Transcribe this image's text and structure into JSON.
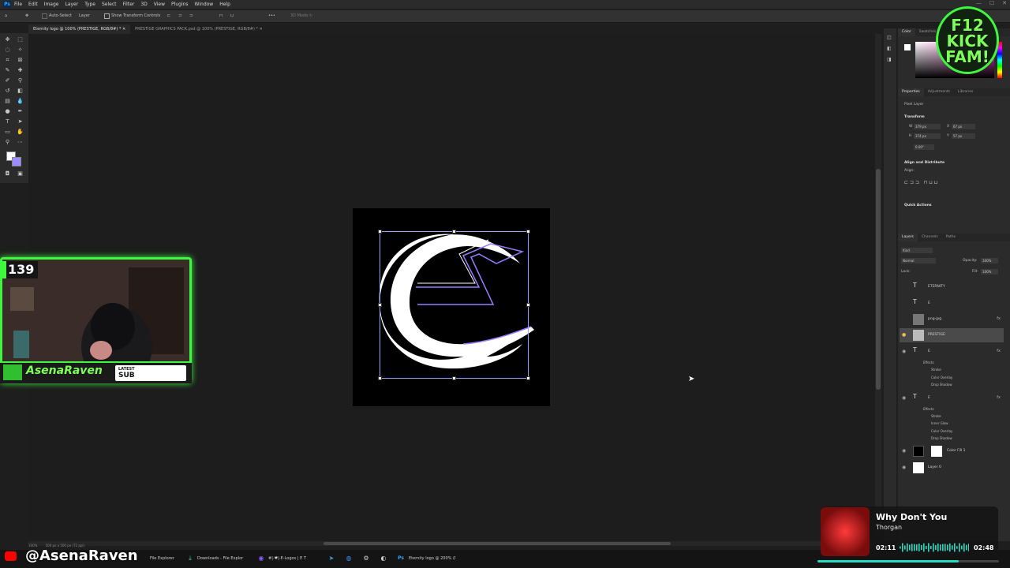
{
  "menubar": {
    "logo": "Ps",
    "items": [
      "File",
      "Edit",
      "Image",
      "Layer",
      "Type",
      "Select",
      "Filter",
      "3D",
      "View",
      "Plugins",
      "Window",
      "Help"
    ]
  },
  "options": {
    "auto_select": "Auto-Select",
    "target": "Layer",
    "transform_controls": "Show Transform Controls",
    "mode_3d": "3D Mode:"
  },
  "tabs": [
    {
      "label": "Eternity logo @ 100% (PRESTIGE, RGB/8#) *",
      "active": true
    },
    {
      "label": "PRESTIGE GRAPHICS PACK.psd @ 100% (PRESTIGE, RGB/8#) *",
      "active": false
    }
  ],
  "status": {
    "zoom": "100%",
    "doc_size": "500 px x 500 px (72 ppi)"
  },
  "panels": {
    "color_tabs": [
      "Color",
      "Swatches"
    ],
    "props_tabs": [
      "Properties",
      "Adjustments",
      "Libraries"
    ],
    "pixel_layer": "Pixel Layer",
    "transform": "Transform",
    "w": "379 px",
    "h": "374 px",
    "x": "67 px",
    "y": "57 px",
    "angle": "0.00°",
    "align": "Align and Distribute",
    "align_sub": "Align:",
    "quick_actions": "Quick Actions",
    "layers_tabs": [
      "Layers",
      "Channels",
      "Paths"
    ],
    "kind": "Kind",
    "blend": "Normal",
    "opacity_label": "Opacity:",
    "opacity": "100%",
    "lock_label": "Lock:",
    "fill_label": "Fill:",
    "fill": "100%"
  },
  "layers": [
    {
      "name": "ETERNITY",
      "type": "text",
      "visible": false,
      "selected": false,
      "fx": false
    },
    {
      "name": "E",
      "type": "text",
      "visible": false,
      "selected": false,
      "fx": false
    },
    {
      "name": "png-jpg",
      "type": "pixel",
      "visible": false,
      "selected": false,
      "fx": true
    },
    {
      "name": "PRESTIGE",
      "type": "pixel",
      "visible": true,
      "selected": true,
      "fx": false
    },
    {
      "name": "E",
      "type": "text",
      "visible": true,
      "selected": false,
      "fx": true
    },
    {
      "name": "E",
      "type": "text",
      "visible": true,
      "selected": false,
      "fx": true
    },
    {
      "name": "Color Fill 1",
      "type": "fill",
      "visible": true,
      "selected": false,
      "fx": false
    },
    {
      "name": "Layer 0",
      "type": "pixel",
      "visible": true,
      "selected": false,
      "fx": false
    }
  ],
  "effects_a": [
    "Effects",
    "Stroke",
    "Color Overlay",
    "Drop Shadow"
  ],
  "effects_b": [
    "Effects",
    "Stroke",
    "Inner Glow",
    "Color Overlay",
    "Drop Shadow"
  ],
  "taskbar": {
    "items": [
      "File Explorer",
      "Downloads - File Explor",
      "#|-♥|-E-Logos | E T",
      "Eternity logo @ 200% (I"
    ]
  },
  "overlay": {
    "sub_count": "139",
    "streamer": "AsenaRaven",
    "latest_label": "LATEST",
    "latest_value": "SUB",
    "handle": "@AsenaRaven",
    "badge": "F12 KICK FAM!"
  },
  "music": {
    "title": "Why Don't You",
    "artist": "Thorgan",
    "elapsed": "02:11",
    "total": "02:48",
    "progress": 0.78
  },
  "colors": {
    "accent_green": "#3ef73e",
    "ps_blue": "#31a8ff",
    "selection": "#9aa0ff",
    "progress": "#29d9c2"
  }
}
